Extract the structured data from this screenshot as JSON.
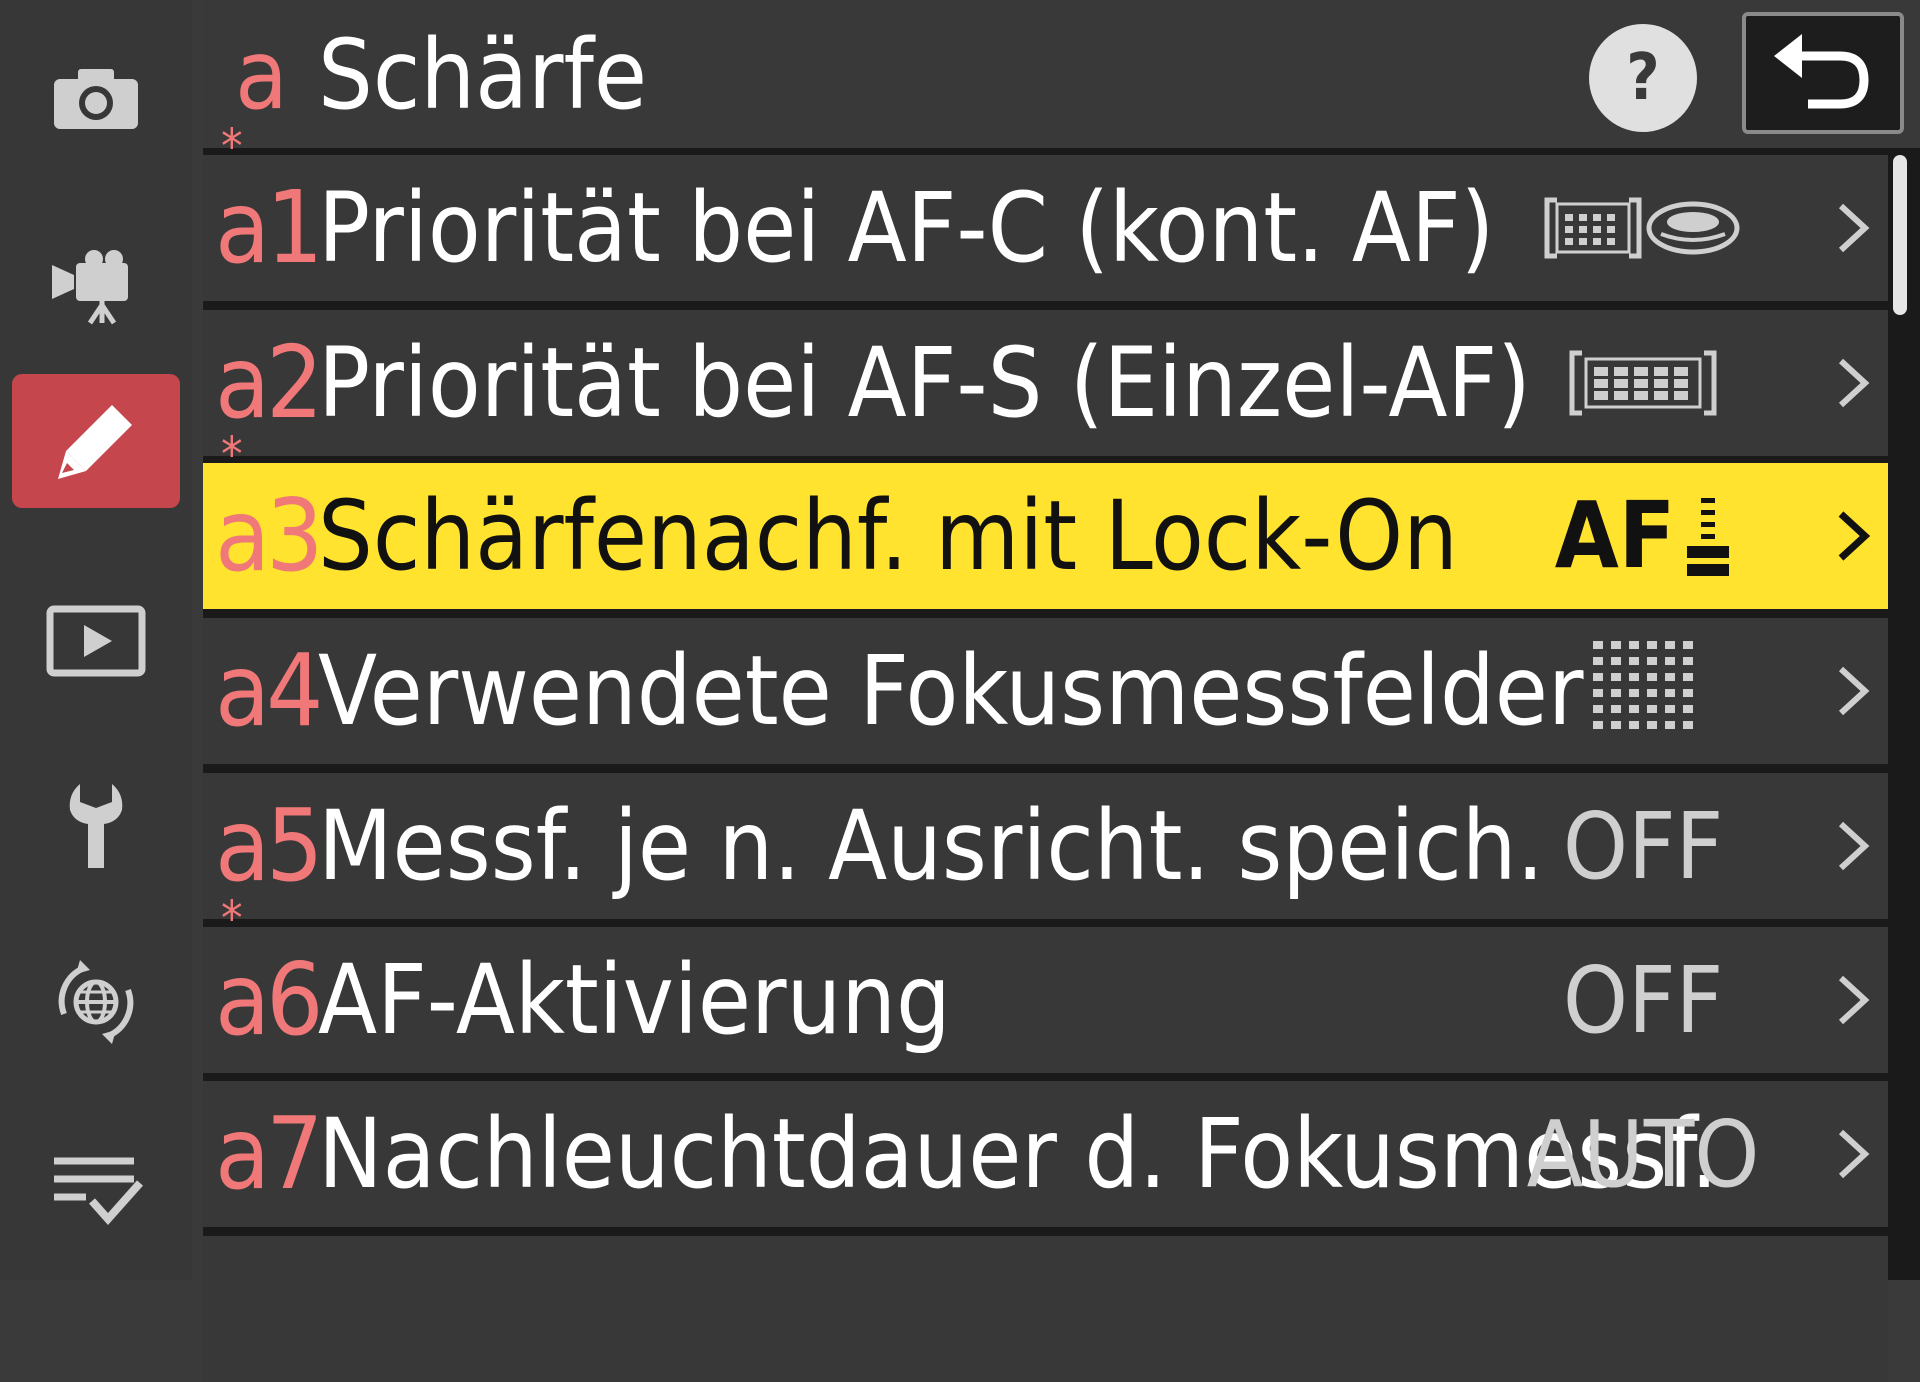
{
  "sidebar": {
    "items": [
      {
        "icon": "camera-icon"
      },
      {
        "icon": "video-camera-icon"
      },
      {
        "icon": "pencil-icon",
        "active": true
      },
      {
        "icon": "playback-icon"
      },
      {
        "icon": "wrench-icon"
      },
      {
        "icon": "network-icon"
      },
      {
        "icon": "my-menu-icon"
      }
    ]
  },
  "header": {
    "letter": "a",
    "title": "Schärfe",
    "help_label": "?"
  },
  "menu": {
    "rows": [
      {
        "num": "a1",
        "star": "*",
        "label": "Priorität bei AF-C (kont. AF)",
        "value_icon": "af-c-priority-icon"
      },
      {
        "num": "a2",
        "star": "",
        "label": "Priorität bei AF-S (Einzel-AF)",
        "value_icon": "af-s-priority-icon"
      },
      {
        "num": "a3",
        "star": "*",
        "label": "Schärfenachf. mit Lock-On",
        "value": "AF",
        "value_icon": "lock-on-level-icon",
        "selected": true
      },
      {
        "num": "a4",
        "star": "",
        "label": "Verwendete Fokusmessfelder",
        "value_icon": "focus-points-grid-icon"
      },
      {
        "num": "a5",
        "star": "",
        "label": "Messf. je n. Ausricht. speich.",
        "value": "OFF"
      },
      {
        "num": "a6",
        "star": "*",
        "label": "AF-Aktivierung",
        "value": "OFF"
      },
      {
        "num": "a7",
        "star": "",
        "label": "Nachleuchtdauer d. Fokusmessf.",
        "value": "AUTO"
      }
    ]
  },
  "colors": {
    "background": "#1a1a1a",
    "row": "#383838",
    "highlight": "#ffe32f",
    "accent": "#f07878",
    "sidebar_active": "#c5464c"
  }
}
